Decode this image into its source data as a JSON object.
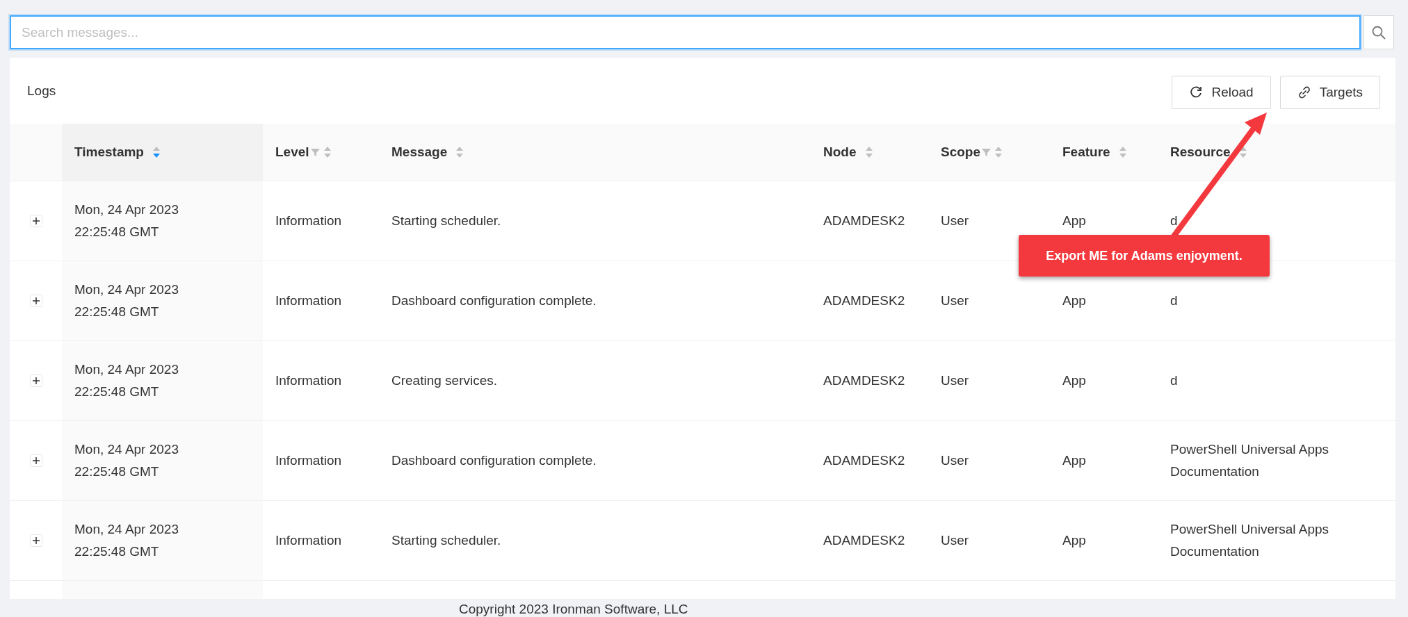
{
  "search": {
    "placeholder": "Search messages..."
  },
  "card": {
    "title": "Logs",
    "buttons": [
      {
        "label": "Reload",
        "kind": "reload"
      },
      {
        "label": "Targets",
        "kind": "link"
      }
    ]
  },
  "table": {
    "columns": [
      {
        "label": "Timestamp",
        "sorted_descending": true,
        "filter": false
      },
      {
        "label": "Level",
        "sorted_descending": false,
        "filter": true
      },
      {
        "label": "Message",
        "sorted_descending": false,
        "filter": false
      },
      {
        "label": "Node",
        "sorted_descending": false,
        "filter": false
      },
      {
        "label": "Scope",
        "sorted_descending": false,
        "filter": true
      },
      {
        "label": "Feature",
        "sorted_descending": false,
        "filter": false
      },
      {
        "label": "Resource",
        "sorted_descending": false,
        "filter": false
      }
    ],
    "rows": [
      {
        "cells": [
          "Mon, 24 Apr 2023 22:25:48 GMT",
          "Information",
          "Starting scheduler.",
          "ADAMDESK2",
          "User",
          "App",
          "d"
        ]
      },
      {
        "cells": [
          "Mon, 24 Apr 2023 22:25:48 GMT",
          "Information",
          "Dashboard configuration complete.",
          "ADAMDESK2",
          "User",
          "App",
          "d"
        ]
      },
      {
        "cells": [
          "Mon, 24 Apr 2023 22:25:48 GMT",
          "Information",
          "Creating services.",
          "ADAMDESK2",
          "User",
          "App",
          "d"
        ]
      },
      {
        "cells": [
          "Mon, 24 Apr 2023 22:25:48 GMT",
          "Information",
          "Dashboard configuration complete.",
          "ADAMDESK2",
          "User",
          "App",
          "PowerShell Universal Apps Documentation"
        ]
      },
      {
        "cells": [
          "Mon, 24 Apr 2023 22:25:48 GMT",
          "Information",
          "Starting scheduler.",
          "ADAMDESK2",
          "User",
          "App",
          "PowerShell Universal Apps Documentation"
        ]
      }
    ]
  },
  "annotation": {
    "text": "Export ME for Adams enjoyment."
  },
  "footer": {
    "text": "Copyright 2023 Ironman Software, LLC"
  }
}
